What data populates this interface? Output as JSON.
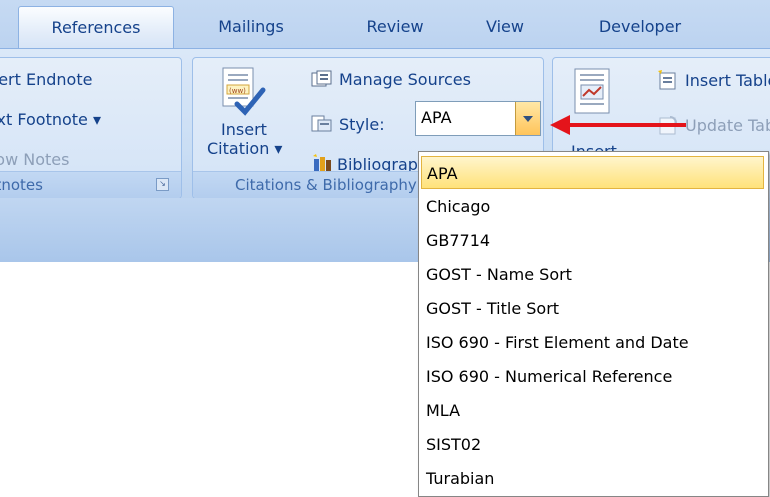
{
  "tabs": [
    {
      "label": "References",
      "active": true
    },
    {
      "label": "Mailings",
      "active": false
    },
    {
      "label": "Review",
      "active": false
    },
    {
      "label": "View",
      "active": false
    },
    {
      "label": "Developer",
      "active": false
    }
  ],
  "footnotes_group": {
    "insert_endnote": "Insert Endnote",
    "next_footnote": "Next Footnote ▾",
    "show_notes": "Show Notes",
    "label": "Footnotes"
  },
  "citations_group": {
    "insert_citation_line1": "Insert",
    "insert_citation_line2": "Citation ▾",
    "manage_sources": "Manage Sources",
    "style_label": "Style:",
    "style_value": "APA",
    "bibliography": "Bibliography",
    "label": "Citations & Bibliography"
  },
  "captions_group": {
    "insert_table": "Insert Table of Figures",
    "update_table": "Update Table",
    "insert_caption": "Insert"
  },
  "style_options": [
    {
      "label": "APA",
      "selected": true
    },
    {
      "label": "Chicago",
      "selected": false
    },
    {
      "label": "GB7714",
      "selected": false
    },
    {
      "label": "GOST - Name Sort",
      "selected": false
    },
    {
      "label": "GOST - Title Sort",
      "selected": false
    },
    {
      "label": "ISO 690 - First Element and Date",
      "selected": false
    },
    {
      "label": "ISO 690 - Numerical Reference",
      "selected": false
    },
    {
      "label": "MLA",
      "selected": false
    },
    {
      "label": "SIST02",
      "selected": false
    },
    {
      "label": "Turabian",
      "selected": false
    }
  ],
  "colors": {
    "accent_arrow": "#e4141b",
    "selection": "#ffe27a",
    "ribbon": "#c9ddf4",
    "text": "#15428b"
  }
}
